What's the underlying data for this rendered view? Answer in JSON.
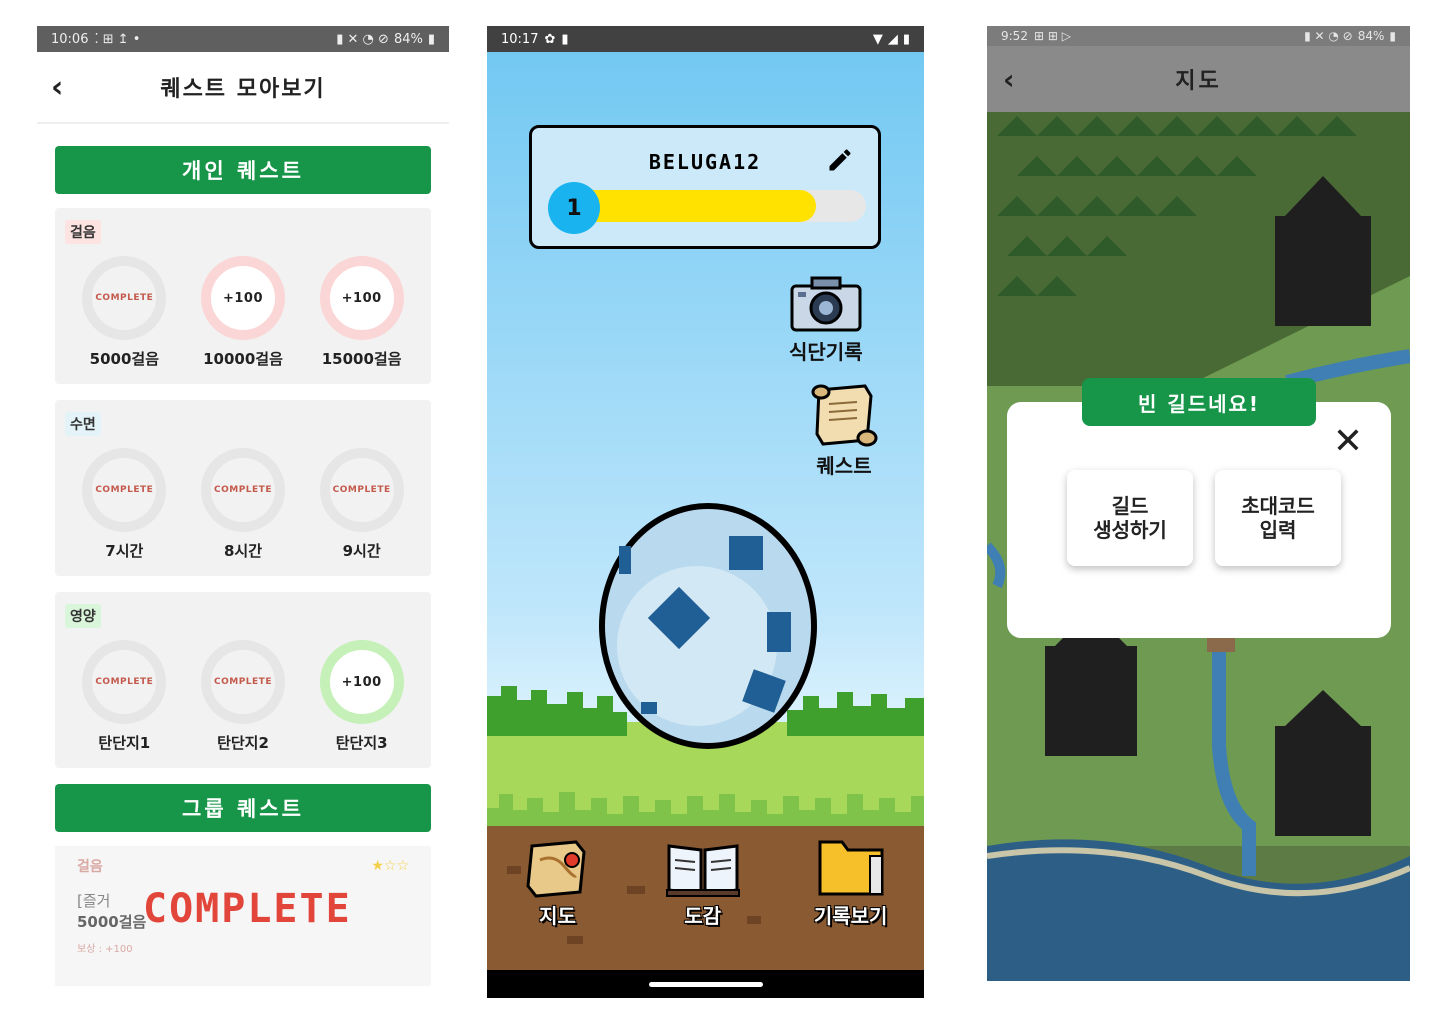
{
  "screen1": {
    "status": {
      "time": "10:06",
      "battery": "84%"
    },
    "title": "퀘스트 모아보기",
    "personal_banner": "개인 퀘스트",
    "categories": [
      {
        "tag": "걸음",
        "items": [
          {
            "state": "COMPLETE",
            "label": "5000걸음"
          },
          {
            "state": "+100",
            "label": "10000걸음"
          },
          {
            "state": "+100",
            "label": "15000걸음"
          }
        ]
      },
      {
        "tag": "수면",
        "items": [
          {
            "state": "COMPLETE",
            "label": "7시간"
          },
          {
            "state": "COMPLETE",
            "label": "8시간"
          },
          {
            "state": "COMPLETE",
            "label": "9시간"
          }
        ]
      },
      {
        "tag": "영양",
        "items": [
          {
            "state": "COMPLETE",
            "label": "탄단지1"
          },
          {
            "state": "COMPLETE",
            "label": "탄단지2"
          },
          {
            "state": "+100",
            "label": "탄단지3"
          }
        ]
      }
    ],
    "group_banner": "그룹 퀘스트",
    "group_card": {
      "tag": "걸음",
      "line1": "[즐거",
      "line2": "5000걸음",
      "reward": "보상 : +100",
      "stamp": "COMPLETE",
      "stars": "★☆☆"
    }
  },
  "screen2": {
    "status": {
      "time": "10:17"
    },
    "username": "BELUGA12",
    "level": "1",
    "xp_fraction": 0.83,
    "diet_label": "식단기록",
    "quest_label": "퀘스트",
    "nav": {
      "map": "지도",
      "book": "도감",
      "records": "기록보기"
    }
  },
  "screen3": {
    "status": {
      "time": "9:52",
      "battery": "84%"
    },
    "title": "지도",
    "dialog_title": "빈 길드네요!",
    "create_guild": "길드\n생성하기",
    "invite_code": "초대코드\n입력"
  }
}
